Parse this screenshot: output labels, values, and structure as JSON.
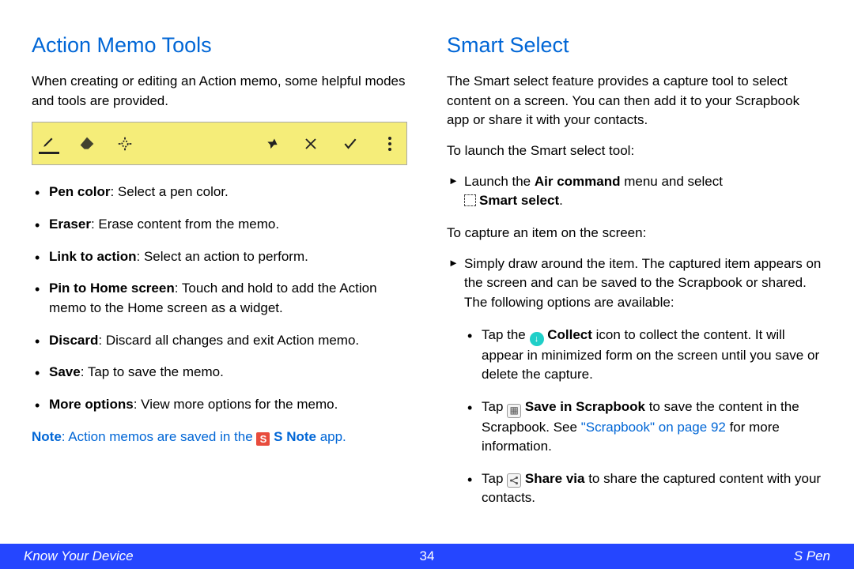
{
  "left": {
    "heading": "Action Memo Tools",
    "intro": "When creating or editing an Action memo, some helpful modes and tools are provided.",
    "items": [
      {
        "term": "Pen color",
        "desc": ": Select a pen color."
      },
      {
        "term": "Eraser",
        "desc": ": Erase content from the memo."
      },
      {
        "term": "Link to action",
        "desc": ": Select an action to perform."
      },
      {
        "term": "Pin to Home screen",
        "desc": ": Touch and hold to add the Action memo to the Home screen as a widget."
      },
      {
        "term": "Discard",
        "desc": ": Discard all changes and exit Action memo."
      },
      {
        "term": "Save",
        "desc": ": Tap to save the memo."
      },
      {
        "term": "More options",
        "desc": ": View more options for the memo."
      }
    ],
    "note_prefix": "Note",
    "note_mid": ": Action memos are saved in the ",
    "snote_letter": "S",
    "note_app": " S Note",
    "note_suffix": " app."
  },
  "right": {
    "heading": "Smart Select",
    "intro": "The Smart select feature provides a capture tool to select content on a screen. You can then add it to your Scrapbook app or share it with your contacts.",
    "launch_label": "To launch the Smart select tool:",
    "launch_pre": "Launch the ",
    "air_cmd": "Air command",
    "launch_mid": " menu and select ",
    "smart_select": "Smart select",
    "launch_post": ".",
    "capture_label": "To capture an item on the screen:",
    "capture_desc": "Simply draw around the item. The captured item appears on the screen and can be saved to the Scrapbook or shared. The following options are available:",
    "opt1_pre": "Tap the ",
    "opt1_icon_glyph": "↓",
    "opt1_bold": " Collect",
    "opt1_post": " icon to collect the content. It will appear in minimized form on the screen until you save or delete the capture.",
    "opt2_pre": "Tap ",
    "opt2_bold": " Save in Scrapbook",
    "opt2_mid": " to save the content in the Scrapbook. See ",
    "opt2_link": "\"Scrapbook\" on page 92",
    "opt2_post": " for more information.",
    "opt3_pre": "Tap ",
    "opt3_bold": " Share via",
    "opt3_post": " to share the captured content with your contacts."
  },
  "footer": {
    "left": "Know Your Device",
    "page": "34",
    "right": "S Pen"
  }
}
